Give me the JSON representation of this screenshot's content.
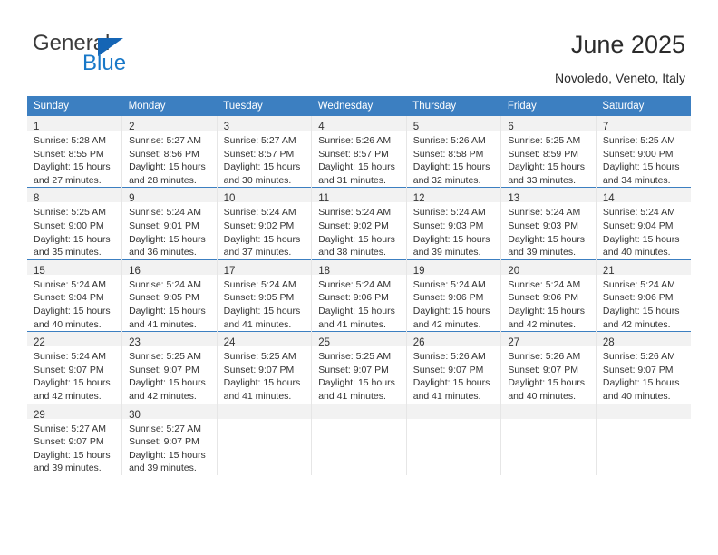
{
  "brand": {
    "name_top": "General",
    "name_bottom": "Blue",
    "triangle_color": "#1565b5",
    "blue_color": "#1878c8"
  },
  "header": {
    "title": "June 2025",
    "subtitle": "Novoledo, Veneto, Italy"
  },
  "colors": {
    "header_row_bg": "#3c7fc1",
    "header_row_text": "#ffffff",
    "daynum_strip_bg": "#f2f2f2",
    "row_divider": "#3c7fc1",
    "cell_divider": "#e6e6e6",
    "body_text": "#333333"
  },
  "weekdays": [
    "Sunday",
    "Monday",
    "Tuesday",
    "Wednesday",
    "Thursday",
    "Friday",
    "Saturday"
  ],
  "labels": {
    "sunrise_prefix": "Sunrise:",
    "sunset_prefix": "Sunset:",
    "daylight_prefix": "Daylight:"
  },
  "weeks": [
    [
      {
        "day": "1",
        "sunrise": "Sunrise: 5:28 AM",
        "sunset": "Sunset: 8:55 PM",
        "daylight_1": "Daylight: 15 hours",
        "daylight_2": "and 27 minutes."
      },
      {
        "day": "2",
        "sunrise": "Sunrise: 5:27 AM",
        "sunset": "Sunset: 8:56 PM",
        "daylight_1": "Daylight: 15 hours",
        "daylight_2": "and 28 minutes."
      },
      {
        "day": "3",
        "sunrise": "Sunrise: 5:27 AM",
        "sunset": "Sunset: 8:57 PM",
        "daylight_1": "Daylight: 15 hours",
        "daylight_2": "and 30 minutes."
      },
      {
        "day": "4",
        "sunrise": "Sunrise: 5:26 AM",
        "sunset": "Sunset: 8:57 PM",
        "daylight_1": "Daylight: 15 hours",
        "daylight_2": "and 31 minutes."
      },
      {
        "day": "5",
        "sunrise": "Sunrise: 5:26 AM",
        "sunset": "Sunset: 8:58 PM",
        "daylight_1": "Daylight: 15 hours",
        "daylight_2": "and 32 minutes."
      },
      {
        "day": "6",
        "sunrise": "Sunrise: 5:25 AM",
        "sunset": "Sunset: 8:59 PM",
        "daylight_1": "Daylight: 15 hours",
        "daylight_2": "and 33 minutes."
      },
      {
        "day": "7",
        "sunrise": "Sunrise: 5:25 AM",
        "sunset": "Sunset: 9:00 PM",
        "daylight_1": "Daylight: 15 hours",
        "daylight_2": "and 34 minutes."
      }
    ],
    [
      {
        "day": "8",
        "sunrise": "Sunrise: 5:25 AM",
        "sunset": "Sunset: 9:00 PM",
        "daylight_1": "Daylight: 15 hours",
        "daylight_2": "and 35 minutes."
      },
      {
        "day": "9",
        "sunrise": "Sunrise: 5:24 AM",
        "sunset": "Sunset: 9:01 PM",
        "daylight_1": "Daylight: 15 hours",
        "daylight_2": "and 36 minutes."
      },
      {
        "day": "10",
        "sunrise": "Sunrise: 5:24 AM",
        "sunset": "Sunset: 9:02 PM",
        "daylight_1": "Daylight: 15 hours",
        "daylight_2": "and 37 minutes."
      },
      {
        "day": "11",
        "sunrise": "Sunrise: 5:24 AM",
        "sunset": "Sunset: 9:02 PM",
        "daylight_1": "Daylight: 15 hours",
        "daylight_2": "and 38 minutes."
      },
      {
        "day": "12",
        "sunrise": "Sunrise: 5:24 AM",
        "sunset": "Sunset: 9:03 PM",
        "daylight_1": "Daylight: 15 hours",
        "daylight_2": "and 39 minutes."
      },
      {
        "day": "13",
        "sunrise": "Sunrise: 5:24 AM",
        "sunset": "Sunset: 9:03 PM",
        "daylight_1": "Daylight: 15 hours",
        "daylight_2": "and 39 minutes."
      },
      {
        "day": "14",
        "sunrise": "Sunrise: 5:24 AM",
        "sunset": "Sunset: 9:04 PM",
        "daylight_1": "Daylight: 15 hours",
        "daylight_2": "and 40 minutes."
      }
    ],
    [
      {
        "day": "15",
        "sunrise": "Sunrise: 5:24 AM",
        "sunset": "Sunset: 9:04 PM",
        "daylight_1": "Daylight: 15 hours",
        "daylight_2": "and 40 minutes."
      },
      {
        "day": "16",
        "sunrise": "Sunrise: 5:24 AM",
        "sunset": "Sunset: 9:05 PM",
        "daylight_1": "Daylight: 15 hours",
        "daylight_2": "and 41 minutes."
      },
      {
        "day": "17",
        "sunrise": "Sunrise: 5:24 AM",
        "sunset": "Sunset: 9:05 PM",
        "daylight_1": "Daylight: 15 hours",
        "daylight_2": "and 41 minutes."
      },
      {
        "day": "18",
        "sunrise": "Sunrise: 5:24 AM",
        "sunset": "Sunset: 9:06 PM",
        "daylight_1": "Daylight: 15 hours",
        "daylight_2": "and 41 minutes."
      },
      {
        "day": "19",
        "sunrise": "Sunrise: 5:24 AM",
        "sunset": "Sunset: 9:06 PM",
        "daylight_1": "Daylight: 15 hours",
        "daylight_2": "and 42 minutes."
      },
      {
        "day": "20",
        "sunrise": "Sunrise: 5:24 AM",
        "sunset": "Sunset: 9:06 PM",
        "daylight_1": "Daylight: 15 hours",
        "daylight_2": "and 42 minutes."
      },
      {
        "day": "21",
        "sunrise": "Sunrise: 5:24 AM",
        "sunset": "Sunset: 9:06 PM",
        "daylight_1": "Daylight: 15 hours",
        "daylight_2": "and 42 minutes."
      }
    ],
    [
      {
        "day": "22",
        "sunrise": "Sunrise: 5:24 AM",
        "sunset": "Sunset: 9:07 PM",
        "daylight_1": "Daylight: 15 hours",
        "daylight_2": "and 42 minutes."
      },
      {
        "day": "23",
        "sunrise": "Sunrise: 5:25 AM",
        "sunset": "Sunset: 9:07 PM",
        "daylight_1": "Daylight: 15 hours",
        "daylight_2": "and 42 minutes."
      },
      {
        "day": "24",
        "sunrise": "Sunrise: 5:25 AM",
        "sunset": "Sunset: 9:07 PM",
        "daylight_1": "Daylight: 15 hours",
        "daylight_2": "and 41 minutes."
      },
      {
        "day": "25",
        "sunrise": "Sunrise: 5:25 AM",
        "sunset": "Sunset: 9:07 PM",
        "daylight_1": "Daylight: 15 hours",
        "daylight_2": "and 41 minutes."
      },
      {
        "day": "26",
        "sunrise": "Sunrise: 5:26 AM",
        "sunset": "Sunset: 9:07 PM",
        "daylight_1": "Daylight: 15 hours",
        "daylight_2": "and 41 minutes."
      },
      {
        "day": "27",
        "sunrise": "Sunrise: 5:26 AM",
        "sunset": "Sunset: 9:07 PM",
        "daylight_1": "Daylight: 15 hours",
        "daylight_2": "and 40 minutes."
      },
      {
        "day": "28",
        "sunrise": "Sunrise: 5:26 AM",
        "sunset": "Sunset: 9:07 PM",
        "daylight_1": "Daylight: 15 hours",
        "daylight_2": "and 40 minutes."
      }
    ],
    [
      {
        "day": "29",
        "sunrise": "Sunrise: 5:27 AM",
        "sunset": "Sunset: 9:07 PM",
        "daylight_1": "Daylight: 15 hours",
        "daylight_2": "and 39 minutes."
      },
      {
        "day": "30",
        "sunrise": "Sunrise: 5:27 AM",
        "sunset": "Sunset: 9:07 PM",
        "daylight_1": "Daylight: 15 hours",
        "daylight_2": "and 39 minutes."
      },
      {
        "day": "",
        "sunrise": "",
        "sunset": "",
        "daylight_1": "",
        "daylight_2": ""
      },
      {
        "day": "",
        "sunrise": "",
        "sunset": "",
        "daylight_1": "",
        "daylight_2": ""
      },
      {
        "day": "",
        "sunrise": "",
        "sunset": "",
        "daylight_1": "",
        "daylight_2": ""
      },
      {
        "day": "",
        "sunrise": "",
        "sunset": "",
        "daylight_1": "",
        "daylight_2": ""
      },
      {
        "day": "",
        "sunrise": "",
        "sunset": "",
        "daylight_1": "",
        "daylight_2": ""
      }
    ]
  ]
}
